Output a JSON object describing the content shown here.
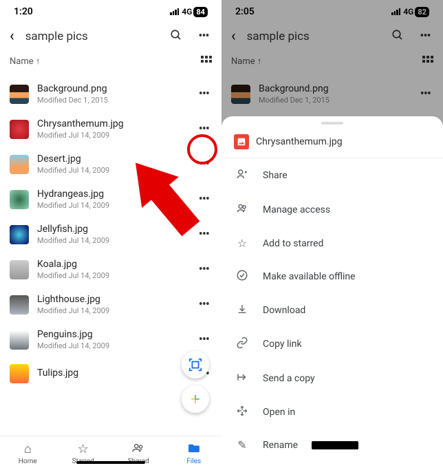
{
  "status": {
    "time_left": "1:20",
    "time_right": "2:05",
    "net": "4G",
    "battery_left": "84",
    "battery_right": "82"
  },
  "header": {
    "title": "sample pics",
    "sort_label": "Name ↑"
  },
  "files": [
    {
      "name": "Background.png",
      "modified": "Modified Dec 1, 2015"
    },
    {
      "name": "Chrysanthemum.jpg",
      "modified": "Modified Jul 14, 2009"
    },
    {
      "name": "Desert.jpg",
      "modified": "Modified Jul 14, 2009"
    },
    {
      "name": "Hydrangeas.jpg",
      "modified": "Modified Jul 14, 2009"
    },
    {
      "name": "Jellyfish.jpg",
      "modified": "Modified Jul 14, 2009"
    },
    {
      "name": "Koala.jpg",
      "modified": "Modified Jul 14, 2009"
    },
    {
      "name": "Lighthouse.jpg",
      "modified": "Modified Jul 14, 2009"
    },
    {
      "name": "Penguins.jpg",
      "modified": "Modified Jul 14, 2009"
    },
    {
      "name": "Tulips.jpg",
      "modified": ""
    }
  ],
  "nav": {
    "home": "Home",
    "starred": "Starred",
    "shared": "Shared",
    "files": "Files"
  },
  "sheet": {
    "title": "Chrysanthemum.jpg",
    "items": [
      {
        "icon": "person-add",
        "label": "Share"
      },
      {
        "icon": "people",
        "label": "Manage access"
      },
      {
        "icon": "star",
        "label": "Add to starred"
      },
      {
        "icon": "offline",
        "label": "Make available offline"
      },
      {
        "icon": "download",
        "label": "Download"
      },
      {
        "icon": "link",
        "label": "Copy link"
      },
      {
        "icon": "send",
        "label": "Send a copy"
      },
      {
        "icon": "open",
        "label": "Open in"
      },
      {
        "icon": "rename",
        "label": "Rename"
      }
    ]
  }
}
